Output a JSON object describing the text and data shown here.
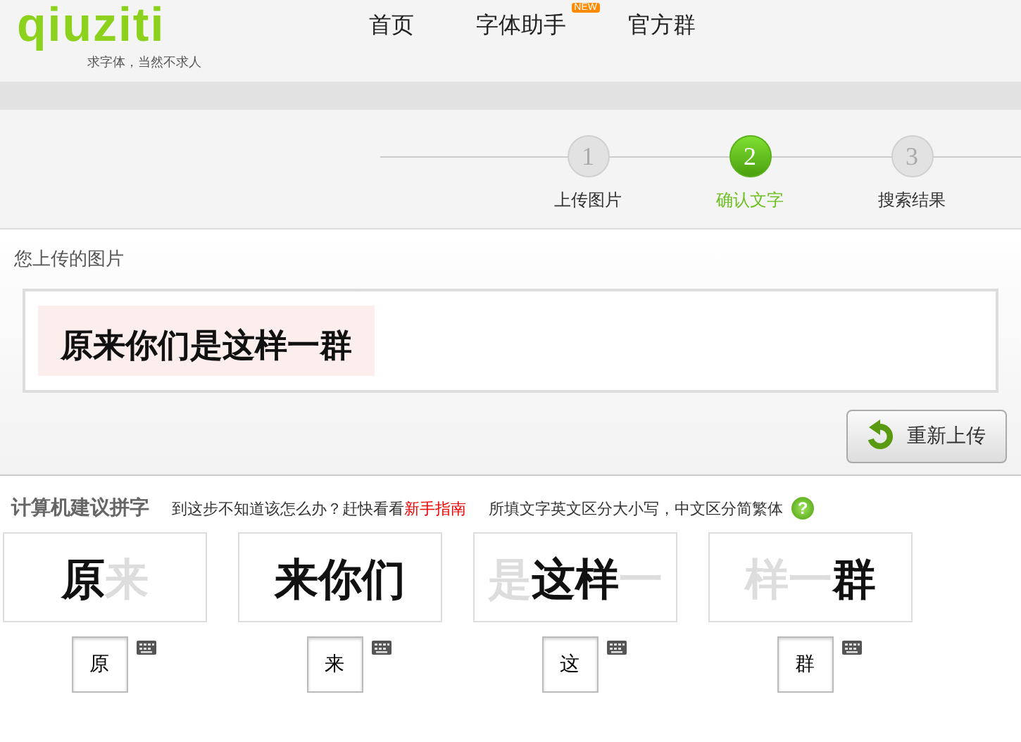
{
  "header": {
    "logo": "qiuziti",
    "tagline": "求字体，当然不求人",
    "nav": [
      {
        "label": "首页"
      },
      {
        "label": "字体助手",
        "badge": "NEW"
      },
      {
        "label": "官方群"
      }
    ]
  },
  "steps": [
    {
      "number": "1",
      "label": "上传图片",
      "selected": false
    },
    {
      "number": "2",
      "label": "确认文字",
      "selected": true
    },
    {
      "number": "3",
      "label": "搜索结果",
      "selected": false
    }
  ],
  "upload": {
    "title": "您上传的图片",
    "image_text": "原来你们是这样一群",
    "button": "重新上传"
  },
  "suggest": {
    "title": "计算机建议拼字",
    "hint_before": "到这步不知道该怎么办？赶快看看",
    "guide_link": "新手指南",
    "hint_after": "所填文字英文区分大小写，中文区分简繁体",
    "help": "?"
  },
  "tiles": [
    {
      "segments": [
        {
          "text": "原",
          "focus": true
        },
        {
          "text": "来",
          "focus": false
        }
      ],
      "value": "原"
    },
    {
      "segments": [
        {
          "text": "来你们",
          "focus": true
        }
      ],
      "value": "来"
    },
    {
      "segments": [
        {
          "text": "是",
          "focus": false
        },
        {
          "text": "这样",
          "focus": true
        },
        {
          "text": "一",
          "focus": false
        }
      ],
      "value": "这"
    },
    {
      "segments": [
        {
          "text": "样一",
          "focus": false
        },
        {
          "text": "群",
          "focus": true
        }
      ],
      "value": "群"
    }
  ]
}
